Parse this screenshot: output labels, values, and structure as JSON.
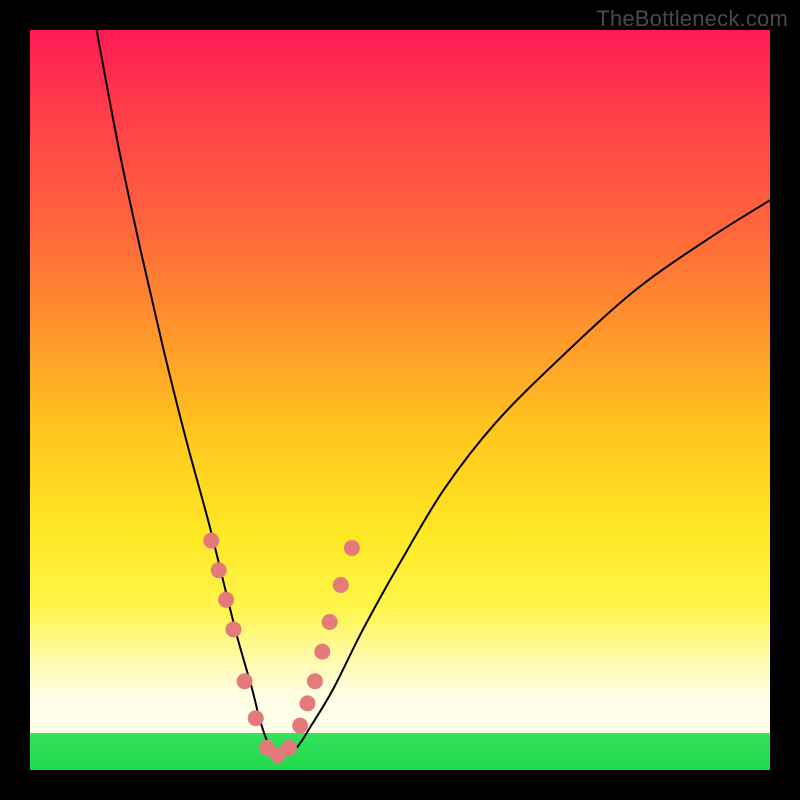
{
  "watermark": "TheBottleneck.com",
  "colors": {
    "background": "#000000",
    "gradient_top": "#ff1a54",
    "gradient_mid": "#ffe824",
    "gradient_bottom_band": "#fffde0",
    "green_stripe": "#1fd94e",
    "curve": "#000000",
    "markers": "#e47a7a"
  },
  "chart_data": {
    "type": "line",
    "title": "",
    "xlabel": "",
    "ylabel": "",
    "xlim": [
      0,
      100
    ],
    "ylim": [
      0,
      100
    ],
    "grid": false,
    "series": [
      {
        "name": "bottleneck-curve",
        "x": [
          9,
          12,
          15,
          18,
          21,
          24,
          26,
          28,
          30,
          31,
          32,
          33,
          34,
          36,
          38,
          41,
          45,
          50,
          56,
          63,
          72,
          82,
          92,
          100
        ],
        "y": [
          100,
          84,
          70,
          57,
          45,
          34,
          26,
          18,
          11,
          7,
          4,
          2,
          2,
          3,
          6,
          11,
          19,
          28,
          38,
          47,
          56,
          65,
          72,
          77
        ]
      }
    ],
    "markers": {
      "name": "highlight-dots",
      "x": [
        24.5,
        25.5,
        26.5,
        27.5,
        29.0,
        30.5,
        32.0,
        33.5,
        35.0,
        36.5,
        37.5,
        38.5,
        39.5,
        40.5,
        42.0,
        43.5
      ],
      "y": [
        31,
        27,
        23,
        19,
        12,
        7,
        3,
        2,
        3,
        6,
        9,
        12,
        16,
        20,
        25,
        30
      ],
      "radius": 8
    }
  }
}
